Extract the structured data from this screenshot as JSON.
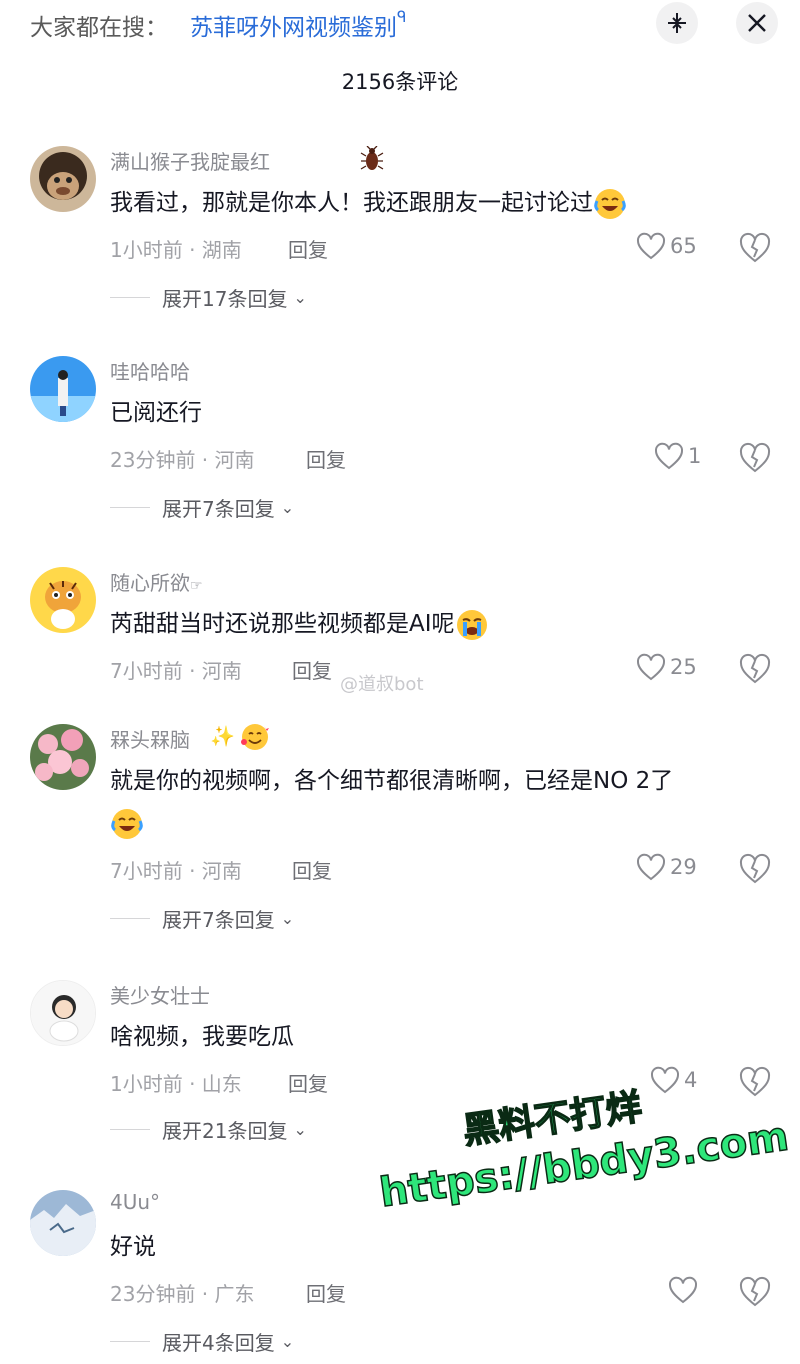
{
  "header": {
    "search_prefix": "大家都在搜：",
    "search_query": "苏菲呀外网视频鉴别",
    "search_glyph": "ᑫ",
    "collapse_icon": "collapse-icon",
    "close_icon": "close-icon"
  },
  "comments_count": "2156条评论",
  "comments": [
    {
      "username": "满山猴子我腚最红",
      "text": "我看过，那就是你本人！我还跟朋友一起讨论过",
      "time_loc": "1小时前 · 湖南",
      "reply": "回复",
      "likes": "65",
      "expand": "展开17条回复"
    },
    {
      "username": "哇哈哈哈",
      "text": "已阅还行",
      "time_loc": "23分钟前 · 河南",
      "reply": "回复",
      "likes": "1",
      "expand": "展开7条回复"
    },
    {
      "username": "随心所欲",
      "username_suffix": "☞",
      "text": "芮甜甜当时还说那些视频都是AI呢",
      "time_loc": "7小时前 · 河南",
      "reply": "回复",
      "likes": "25"
    },
    {
      "username": "槑头槑脑",
      "text": "就是你的视频啊，各个细节都很清晰啊，已经是NO 2了",
      "time_loc": "7小时前 · 河南",
      "reply": "回复",
      "likes": "29",
      "expand": "展开7条回复"
    },
    {
      "username": "美少女壮士",
      "text": "啥视频，我要吃瓜",
      "time_loc": "1小时前 · 山东",
      "reply": "回复",
      "likes": "4",
      "expand": "展开21条回复"
    },
    {
      "username": "4Uu°",
      "text": "好说",
      "time_loc": "23分钟前 · 广东",
      "reply": "回复",
      "likes": "",
      "expand": "展开4条回复"
    }
  ],
  "watermark": "@道叔bot",
  "promo": {
    "line1": "黑料不打烊",
    "line2": "https://bbdy3.com"
  },
  "colors": {
    "link": "#2a6cd8",
    "promo": "#2ee67a",
    "meta": "#a1a2a7"
  }
}
